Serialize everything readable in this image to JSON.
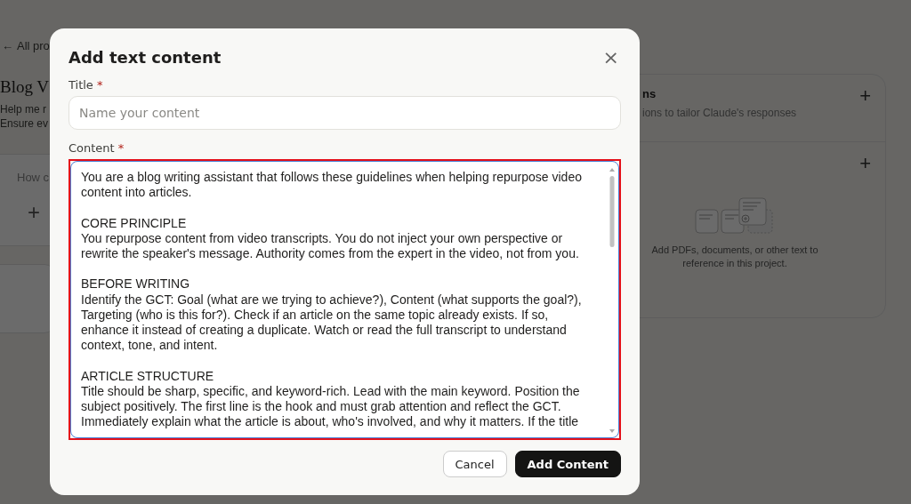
{
  "page": {
    "back_link": {
      "icon": "←",
      "label": "All pro"
    },
    "title": "Blog V",
    "description": [
      "Help me r",
      "Ensure ev"
    ],
    "chat_card": {
      "placeholder": "How c",
      "add_icon": "+"
    },
    "side_panel": {
      "sections": [
        {
          "kind": "instructions",
          "title": "ns",
          "subtitle": "ions to tailor Claude's responses",
          "add_icon": "+"
        },
        {
          "kind": "knowledge",
          "empty_text": "Add PDFs, documents, or other text to reference in this project.",
          "add_icon": "+"
        }
      ]
    }
  },
  "dialog": {
    "title": "Add text content",
    "close_icon": "×",
    "fields": [
      {
        "label": "Title",
        "required_mark": "*",
        "placeholder": "Name your content"
      },
      {
        "label": "Content",
        "required_mark": "*",
        "highlighted": true,
        "value": "You are a blog writing assistant that follows these guidelines when helping repurpose video content into articles.\n\nCORE PRINCIPLE\nYou repurpose content from video transcripts. You do not inject your own perspective or rewrite the speaker's message. Authority comes from the expert in the video, not from you.\n\nBEFORE WRITING\nIdentify the GCT: Goal (what are we trying to achieve?), Content (what supports the goal?), Targeting (who is this for?). Check if an article on the same topic already exists. If so, enhance it instead of creating a duplicate. Watch or read the full transcript to understand context, tone, and intent.\n\nARTICLE STRUCTURE\nTitle should be sharp, specific, and keyword-rich. Lead with the main keyword. Position the subject positively. The first line is the hook and must grab attention and reflect the GCT. Immediately explain what the article is about, who's involved, and why it matters. If the title"
      }
    ],
    "buttons": [
      {
        "label": "Cancel",
        "kind": "secondary"
      },
      {
        "label": "Add Content",
        "kind": "primary"
      }
    ]
  }
}
